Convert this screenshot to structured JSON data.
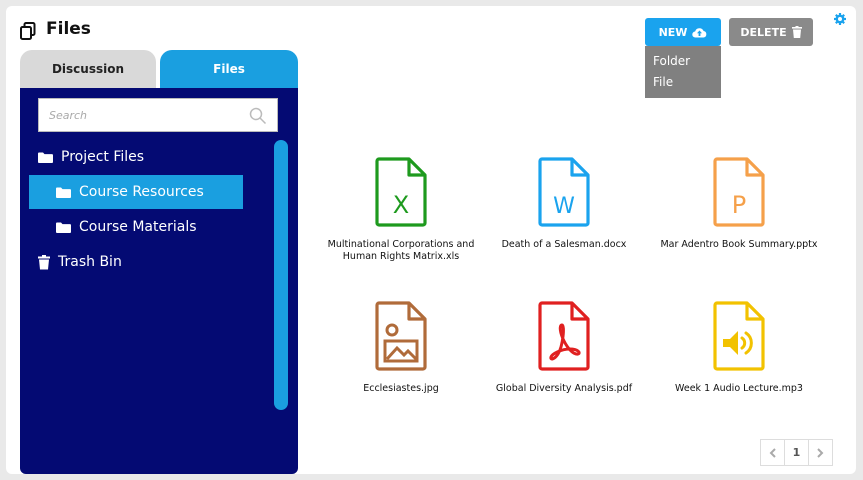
{
  "header": {
    "title": "Files",
    "title_icon": "copy-icon"
  },
  "tabs": [
    {
      "label": "Discussion",
      "active": false
    },
    {
      "label": "Files",
      "active": true
    }
  ],
  "search": {
    "placeholder": "Search",
    "value": ""
  },
  "tree": [
    {
      "label": "Project Files",
      "icon": "folder-icon"
    },
    {
      "label": "Course Resources",
      "icon": "folder-icon",
      "selected": true
    },
    {
      "label": "Course Materials",
      "icon": "folder-icon"
    },
    {
      "label": "Trash Bin",
      "icon": "trash-icon"
    }
  ],
  "toolbar": {
    "new_label": "NEW",
    "delete_label": "DELETE"
  },
  "new_menu": [
    {
      "label": "Folder"
    },
    {
      "label": "File"
    }
  ],
  "files": [
    {
      "name": "Multinational Corporations and Human Rights Matrix.xls",
      "type": "xls",
      "color": "#1e9a1e",
      "glyph": "X"
    },
    {
      "name": "Death of a Salesman.docx",
      "type": "docx",
      "color": "#1aa3ee",
      "glyph": "W"
    },
    {
      "name": "Mar Adentro Book Summary.pptx",
      "type": "pptx",
      "color": "#f5a04a",
      "glyph": "P"
    },
    {
      "name": "Ecclesiastes.jpg",
      "type": "jpg",
      "color": "#b06b3a",
      "glyph": ""
    },
    {
      "name": "Global Diversity Analysis.pdf",
      "type": "pdf",
      "color": "#e02020",
      "glyph": ""
    },
    {
      "name": "Week 1 Audio Lecture.mp3",
      "type": "mp3",
      "color": "#f2c200",
      "glyph": ""
    }
  ],
  "pagination": {
    "current": "1"
  },
  "colors": {
    "accent": "#1a9fe0",
    "sidebar": "#040a73",
    "delete": "#8a8a8a"
  }
}
